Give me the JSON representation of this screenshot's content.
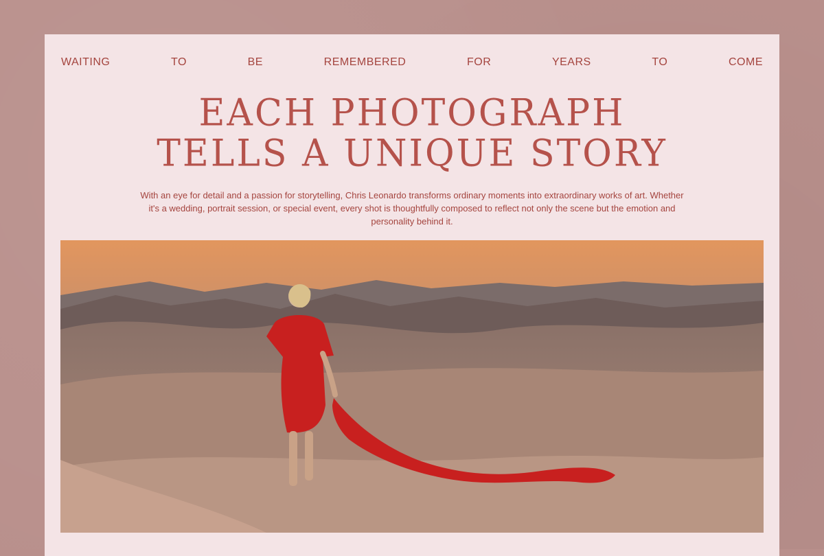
{
  "tagline": {
    "words": [
      "WAITING",
      "TO",
      "BE",
      "REMEMBERED",
      "FOR",
      "YEARS",
      "TO",
      "COME"
    ]
  },
  "headline": {
    "line1": "EACH PHOTOGRAPH",
    "line2": "TELLS A UNIQUE STORY"
  },
  "description": {
    "text": "With an eye for detail and a passion for storytelling, Chris Leonardo transforms ordinary moments into extraordinary works of art. Whether it's a wedding, portrait session, or special event, every shot is thoughtfully composed to reflect not only the scene but the emotion and personality behind it."
  },
  "colors": {
    "page_bg": "#b9908c",
    "card_bg": "#f4e4e6",
    "accent_text": "#a4443e",
    "headline": "#b5524b",
    "dress_red": "#c8201f"
  }
}
